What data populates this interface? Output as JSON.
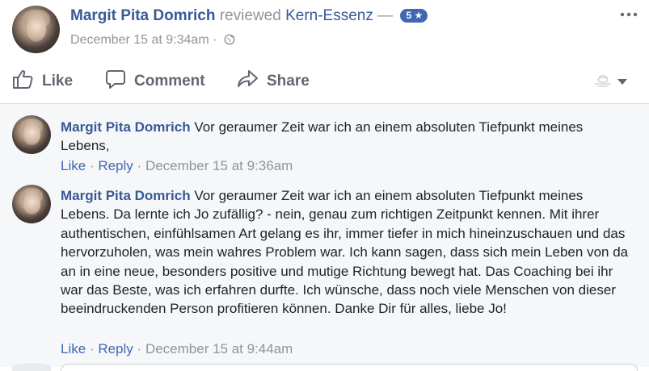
{
  "post": {
    "author": "Margit Pita Domrich",
    "verb": "reviewed",
    "page": "Kern-Essenz",
    "dash": "—",
    "rating": "5",
    "rating_star": "★",
    "date": "December 15 at 9:34am",
    "separator": "·",
    "privacy_icon": "globe-icon"
  },
  "actions": {
    "like": "Like",
    "comment": "Comment",
    "share": "Share"
  },
  "comments": [
    {
      "author": "Margit Pita Domrich",
      "text": "Vor geraumer Zeit war ich an einem absoluten Tiefpunkt meines Lebens,",
      "like": "Like",
      "reply": "Reply",
      "dot": "·",
      "time": "December 15 at 9:36am"
    },
    {
      "author": "Margit Pita Domrich",
      "text": "Vor geraumer Zeit war ich an einem absoluten Tiefpunkt meines Lebens. Da lernte ich Jo zufällig? - nein, genau zum richtigen Zeitpunkt kennen. Mit ihrer authentischen, einfühlsamen Art gelang es ihr, immer tiefer in mich hineinzuschauen und das hervorzuholen, was mein wahres Problem war. Ich kann sagen, dass sich mein Leben von da an in eine neue, besonders positive und mutige Richtung bewegt hat. Das Coaching bei ihr war das Beste, was ich erfahren durfte. Ich wünsche, dass noch viele Menschen von dieser beeindruckenden Person profitieren können. Danke Dir für alles, liebe Jo!",
      "like": "Like",
      "reply": "Reply",
      "dot": "·",
      "time": "December 15 at 9:44am"
    }
  ],
  "colors": {
    "link_blue": "#385898",
    "action_blue": "#4267b2",
    "meta_gray": "#90949c",
    "comments_bg": "#f6f7f9"
  }
}
